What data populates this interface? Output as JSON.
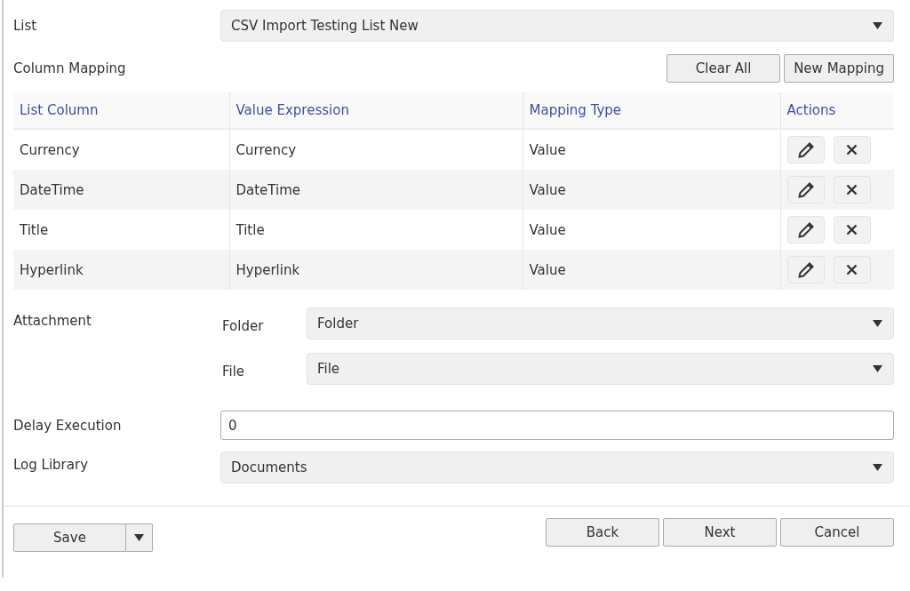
{
  "list": {
    "label": "List",
    "value": "CSV Import Testing List New"
  },
  "column_mapping": {
    "label": "Column Mapping",
    "buttons": [
      "Clear All",
      "New Mapping"
    ],
    "table": {
      "columns": [
        "List Column",
        "Value Expression",
        "Mapping Type",
        "Actions"
      ],
      "rows": [
        {
          "list_column": "Currency",
          "value_expression": "Currency",
          "mapping_type": "Value"
        },
        {
          "list_column": "DateTime",
          "value_expression": "DateTime",
          "mapping_type": "Value"
        },
        {
          "list_column": "Title",
          "value_expression": "Title",
          "mapping_type": "Value"
        },
        {
          "list_column": "Hyperlink",
          "value_expression": "Hyperlink",
          "mapping_type": "Value"
        }
      ]
    }
  },
  "attachment": {
    "label": "Attachment",
    "fields": [
      {
        "label": "Folder",
        "value": "Folder"
      },
      {
        "label": "File",
        "value": "File"
      }
    ]
  },
  "delay_execution": {
    "label": "Delay Execution",
    "value": "0"
  },
  "log_library": {
    "label": "Log Library",
    "value": "Documents"
  },
  "footer": {
    "save": "Save",
    "buttons": [
      "Back",
      "Next",
      "Cancel"
    ]
  }
}
